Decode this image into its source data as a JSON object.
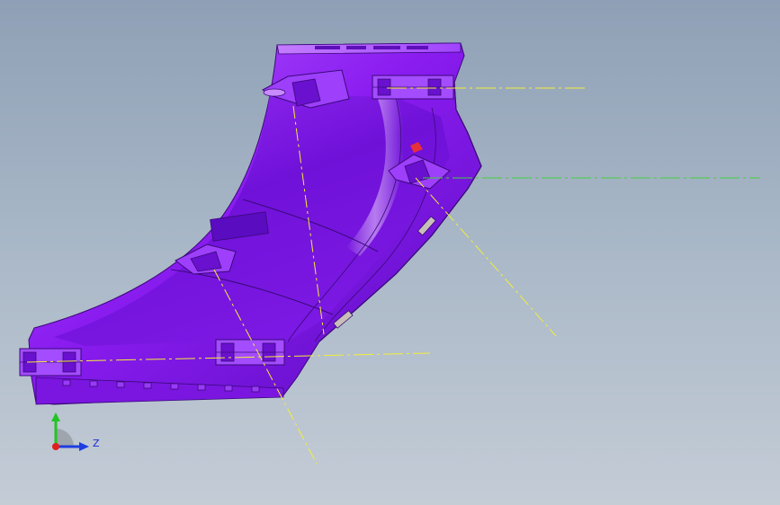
{
  "viewport": {
    "background_top": "#8fa0b6",
    "background_bottom": "#c4ccd6"
  },
  "model": {
    "body_color": "#8a1cf0",
    "highlight_color": "#c36bff",
    "shadow_color": "#4d0aa0",
    "edge_color": "#3a0a78"
  },
  "reference_lines": {
    "yellow": "#f2ee3a",
    "green": "#3ed13e"
  },
  "triad": {
    "z_label": "Z",
    "y_axis_color": "#22c422",
    "z_axis_color": "#1f3de0",
    "x_axis_color": "#e01f1f"
  }
}
